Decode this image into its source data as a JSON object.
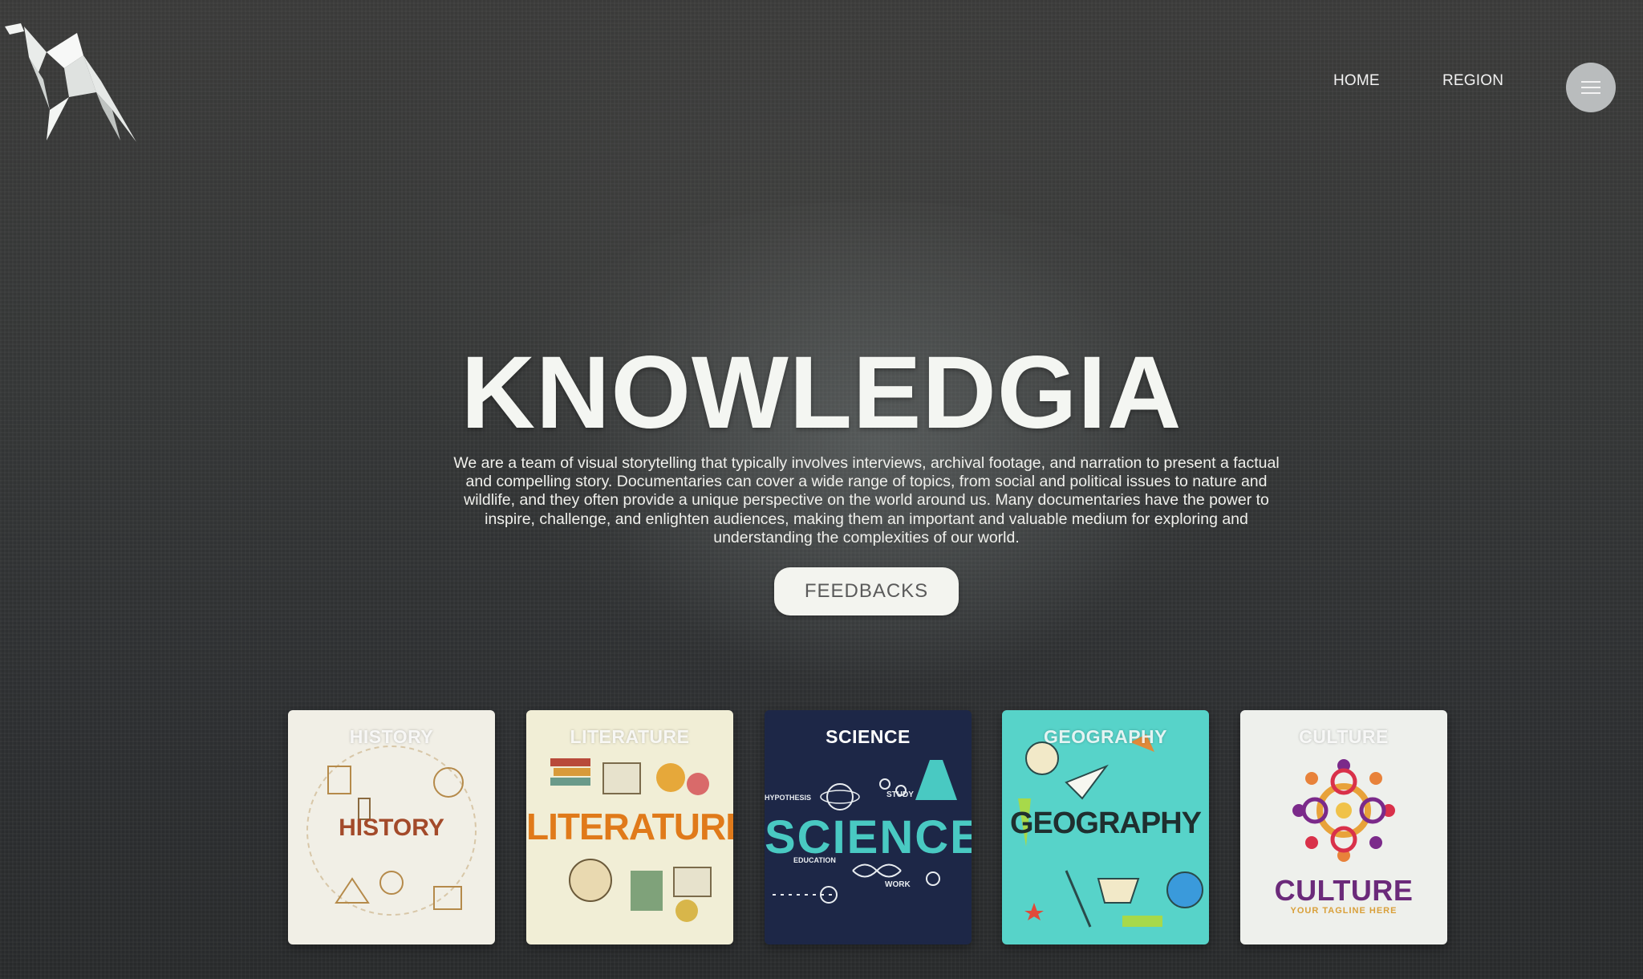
{
  "nav": {
    "home": "HOME",
    "region": "REGION"
  },
  "hero": {
    "title": "KNOWLEDGIA",
    "description": "We are a team of visual storytelling that typically involves interviews, archival footage, and narration to present a factual and compelling story. Documentaries can cover a wide range of topics, from social and political issues to nature and wildlife, and they often provide a unique perspective on the world around us. Many documentaries have the power to inspire, challenge, and enlighten audiences, making them an important and valuable medium for exploring and understanding the complexities of our world.",
    "button": "FEEDBACKS"
  },
  "cards": [
    {
      "title": "HISTORY",
      "art_word": "HISTORY"
    },
    {
      "title": "LITERATURE",
      "art_word": "LITERATURE"
    },
    {
      "title": "SCIENCE",
      "art_word": "SCIENCE",
      "small_labels": [
        "HYPOTHESIS",
        "STUDY",
        "EDUCATION",
        "WORK"
      ]
    },
    {
      "title": "GEOGRAPHY",
      "art_word": "GEOGRAPHY"
    },
    {
      "title": "CULTURE",
      "art_word": "CULTURE",
      "tagline": "YOUR TAGLINE HERE"
    }
  ],
  "colors": {
    "background": "#2f3132",
    "hero_text": "#f4f6f2",
    "button_bg": "#f3f4ef",
    "science_bg": "#1d2747",
    "geography_bg": "#57d3c9",
    "culture_purple": "#6b2a7a"
  },
  "icons": {
    "logo": "origami-horse-logo",
    "menu": "hamburger-menu-icon"
  }
}
